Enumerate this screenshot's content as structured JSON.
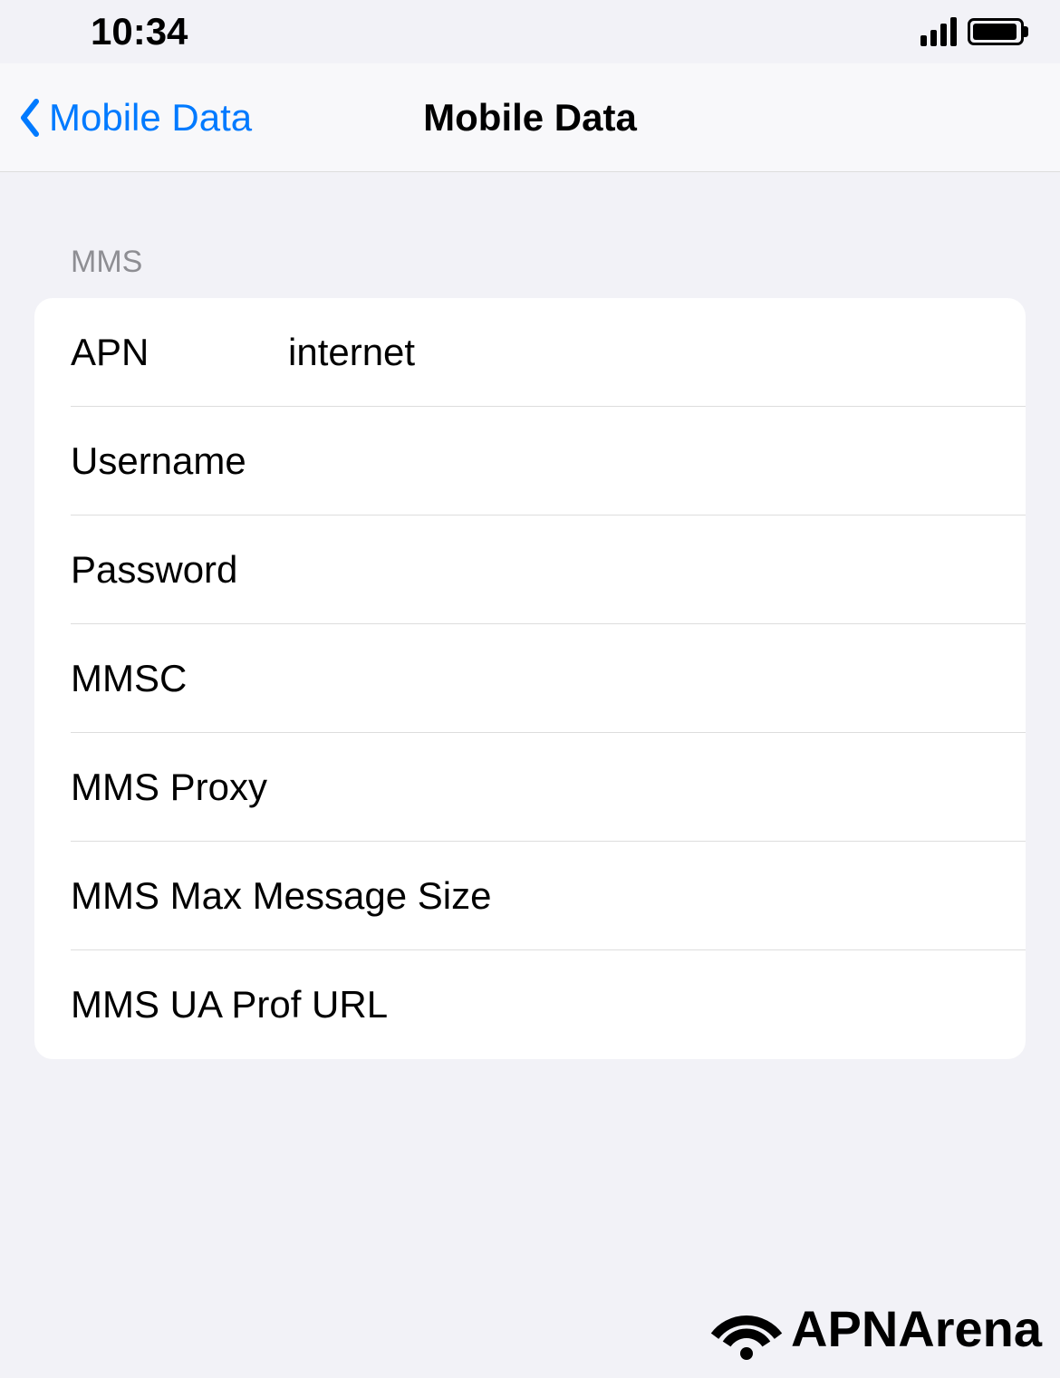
{
  "statusBar": {
    "time": "10:34"
  },
  "navBar": {
    "backLabel": "Mobile Data",
    "title": "Mobile Data"
  },
  "section": {
    "header": "MMS"
  },
  "fields": {
    "apn": {
      "label": "APN",
      "value": "internet"
    },
    "username": {
      "label": "Username",
      "value": ""
    },
    "password": {
      "label": "Password",
      "value": ""
    },
    "mmsc": {
      "label": "MMSC",
      "value": ""
    },
    "mmsProxy": {
      "label": "MMS Proxy",
      "value": ""
    },
    "mmsMaxSize": {
      "label": "MMS Max Message Size",
      "value": ""
    },
    "mmsUaProf": {
      "label": "MMS UA Prof URL",
      "value": ""
    }
  },
  "watermark": {
    "text": "APNArena"
  },
  "footer": {
    "logoText": "APNArena"
  }
}
